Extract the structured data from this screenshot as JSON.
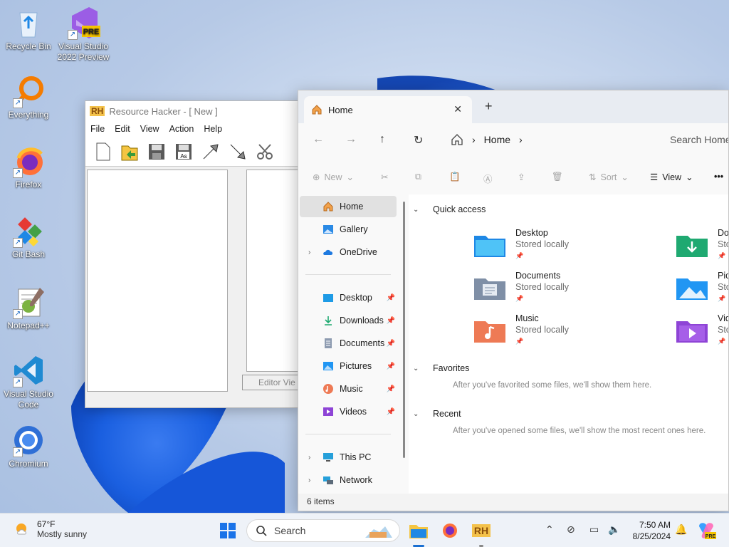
{
  "desktop": {
    "icons": [
      {
        "label": "Recycle Bin",
        "icon": "recycle-bin-icon"
      },
      {
        "label": "Visual Studio 2022 Preview",
        "icon": "visual-studio-icon",
        "badge": "PRE"
      },
      {
        "label": "Everything",
        "icon": "everything-search-icon"
      },
      {
        "label": "Firefox",
        "icon": "firefox-icon"
      },
      {
        "label": "Git Bash",
        "icon": "git-bash-icon"
      },
      {
        "label": "Notepad++",
        "icon": "notepad-plus-plus-icon"
      },
      {
        "label": "Visual Studio Code",
        "icon": "vscode-icon"
      },
      {
        "label": "Chromium",
        "icon": "chromium-icon"
      }
    ]
  },
  "resource_hacker": {
    "logo": "RH",
    "title": "Resource Hacker - [ New ]",
    "menu": [
      "File",
      "Edit",
      "View",
      "Action",
      "Help"
    ],
    "editor_tab": "Editor Vie"
  },
  "explorer": {
    "tab_title": "Home",
    "close_glyph": "✕",
    "new_tab_glyph": "+",
    "breadcrumb": [
      "Home"
    ],
    "search_placeholder": "Search Home",
    "commands": {
      "new": "New",
      "sort": "Sort",
      "view": "View",
      "more": "•••"
    },
    "nav": {
      "top": [
        {
          "label": "Home",
          "icon": "home-icon"
        },
        {
          "label": "Gallery",
          "icon": "gallery-icon"
        },
        {
          "label": "OneDrive",
          "icon": "onedrive-icon"
        }
      ],
      "pinned": [
        {
          "label": "Desktop",
          "icon": "desktop-folder-icon"
        },
        {
          "label": "Downloads",
          "icon": "downloads-icon"
        },
        {
          "label": "Documents",
          "icon": "documents-icon"
        },
        {
          "label": "Pictures",
          "icon": "pictures-icon"
        },
        {
          "label": "Music",
          "icon": "music-icon"
        },
        {
          "label": "Videos",
          "icon": "videos-icon"
        }
      ],
      "bottom": [
        {
          "label": "This PC",
          "icon": "this-pc-icon"
        },
        {
          "label": "Network",
          "icon": "network-icon"
        }
      ]
    },
    "sections": {
      "quick_access": "Quick access",
      "favorites": "Favorites",
      "favorites_msg": "After you've favorited some files, we'll show them here.",
      "recent": "Recent",
      "recent_msg": "After you've opened some files, we'll show the most recent ones here."
    },
    "quick_access_items": [
      {
        "name": "Desktop",
        "sub": "Stored locally",
        "color": "#1e88e5"
      },
      {
        "name": "Do",
        "sub": "Sto",
        "color": "#1fa971"
      },
      {
        "name": "Documents",
        "sub": "Stored locally",
        "color": "#7f8fa6"
      },
      {
        "name": "Pic",
        "sub": "Sto",
        "color": "#2196f3"
      },
      {
        "name": "Music",
        "sub": "Stored locally",
        "color": "#ee7a55"
      },
      {
        "name": "Vid",
        "sub": "Sto",
        "color": "#8e44d6"
      }
    ],
    "status": "6 items"
  },
  "taskbar": {
    "weather_temp": "67°F",
    "weather_desc": "Mostly sunny",
    "search_label": "Search",
    "time": "7:50 AM",
    "date": "8/25/2024",
    "rh_label": "RH",
    "copilot_badge": "PRE"
  }
}
